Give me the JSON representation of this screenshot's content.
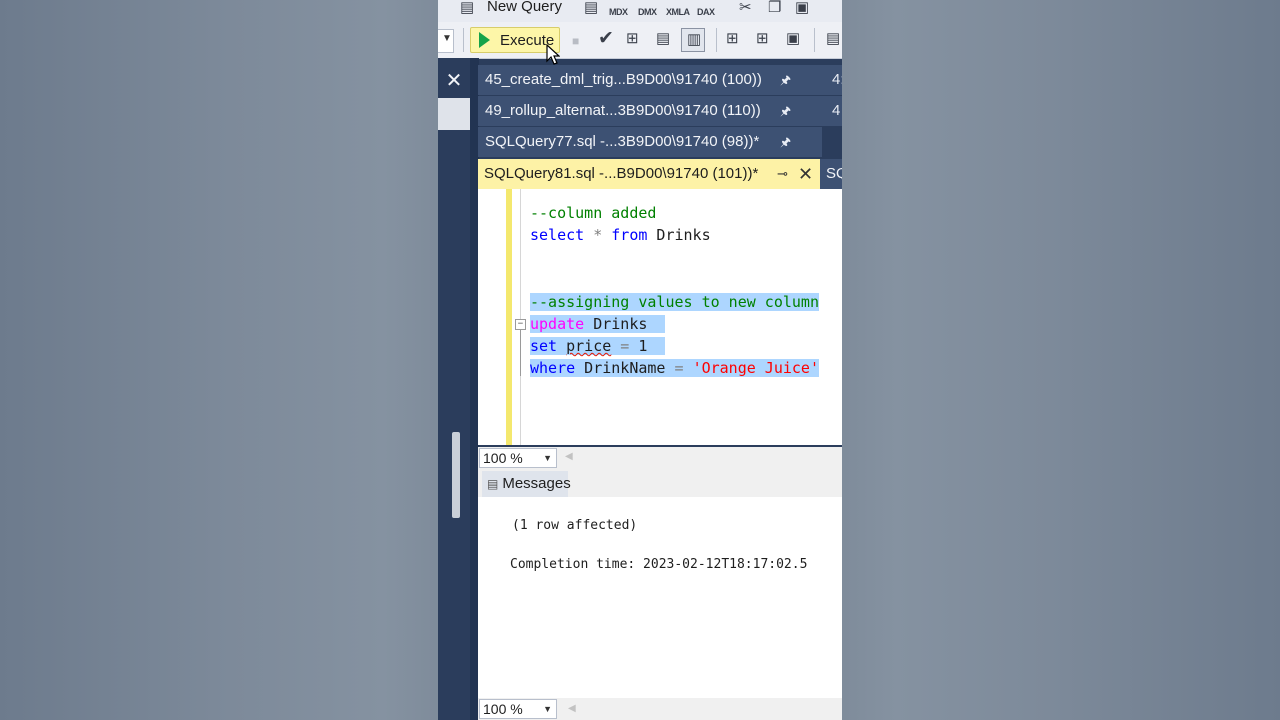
{
  "toolbar": {
    "new_query_label": "New Query",
    "execute_label": "Execute",
    "mdx_label": "MDX",
    "dmx_label": "DMX",
    "xmla_label": "XMLA",
    "dax_label": "DAX"
  },
  "tabs": [
    {
      "label": "45_create_dml_trig...B9D00\\91740 (100))",
      "trail": "4:"
    },
    {
      "label": "49_rollup_alternat...3B9D00\\91740 (110))",
      "trail": "4"
    },
    {
      "label": "SQLQuery77.sql -...3B9D00\\91740 (98))*",
      "trail": ""
    }
  ],
  "active_tab": {
    "label": "SQLQuery81.sql -...B9D00\\91740 (101))*",
    "next_label": "SQ"
  },
  "editor": {
    "line1": "--column added",
    "line2_kw1": "select",
    "line2_op": " * ",
    "line2_kw2": "from",
    "line2_id": " Drinks",
    "line3": "--assigning values to new column",
    "line4_kw": "update",
    "line4_id": " Drinks",
    "line5_kw": "set",
    "line5_sp": " ",
    "line5_col": "price",
    "line5_op": " = ",
    "line5_val": "1",
    "line6_kw": "where",
    "line6_id": " DrinkName",
    "line6_op": " = ",
    "line6_str": "'Orange Juice'"
  },
  "zoom_top": "100 %",
  "results": {
    "messages_tab": "Messages",
    "line1": "(1 row affected)",
    "line2": "Completion time: 2023-02-12T18:17:02.5"
  },
  "zoom_bottom": "100 %"
}
